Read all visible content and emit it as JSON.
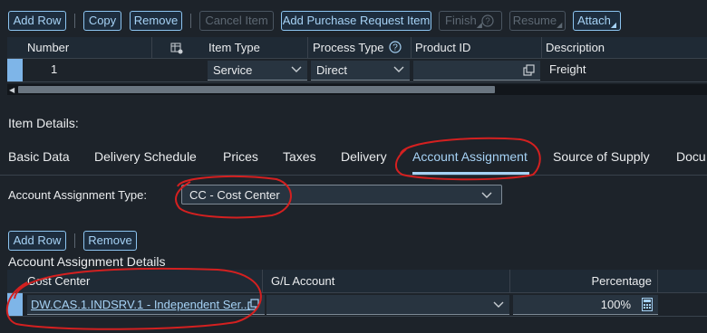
{
  "toolbar": {
    "add_row": "Add Row",
    "copy": "Copy",
    "remove": "Remove",
    "cancel_item": "Cancel Item",
    "add_purchase_request_item": "Add Purchase Request Item",
    "finish": "Finish",
    "resume": "Resume",
    "attach": "Attach"
  },
  "items_table": {
    "columns": {
      "number": "Number",
      "item_type": "Item Type",
      "process_type": "Process Type",
      "product_id": "Product ID",
      "description": "Description"
    },
    "rows": [
      {
        "number": "1",
        "item_type": "Service",
        "process_type": "Direct",
        "product_id": "",
        "description": "Freight"
      }
    ]
  },
  "item_details": {
    "title": "Item Details:",
    "tabs": [
      "Basic Data",
      "Delivery Schedule",
      "Prices",
      "Taxes",
      "Delivery",
      "Account Assignment",
      "Source of Supply",
      "Docu"
    ],
    "active_tab": "Account Assignment"
  },
  "account_assignment": {
    "type_label": "Account Assignment Type:",
    "type_value": "CC - Cost Center",
    "add_row": "Add Row",
    "remove": "Remove",
    "details_title": "Account Assignment Details",
    "columns": {
      "cost_center": "Cost Center",
      "gl_account": "G/L Account",
      "percentage": "Percentage"
    },
    "rows": [
      {
        "cost_center": "DW.CAS.1.INDSRV.1 - Independent Ser...",
        "gl_account": "",
        "percentage": "100%"
      }
    ]
  },
  "colors": {
    "background": "#1d232a",
    "accent": "#a6d2f5",
    "annotation": "#d42020"
  },
  "icons": [
    "help-circle-icon",
    "chevron-down-icon",
    "value-help-icon",
    "calculator-icon",
    "column-settings-icon"
  ]
}
